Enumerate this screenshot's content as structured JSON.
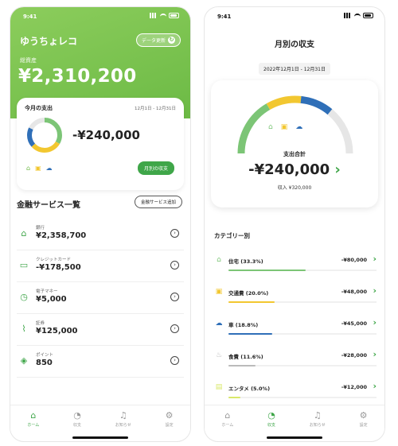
{
  "left": {
    "status_time": "9:41",
    "app_title": "ゆうちょレコ",
    "date_pill": "データ更新",
    "balance_label": "総資産",
    "balance_value": "¥2,310,200",
    "month_card": {
      "title": "今月の支出",
      "range": "12月1日 - 12月31日",
      "amount": "-¥240,000",
      "detail_button": "月別の収支",
      "donut_segments": [
        {
          "share": 0.333,
          "color": "#7cc576"
        },
        {
          "share": 0.3,
          "color": "#f2c730"
        },
        {
          "share": 0.188,
          "color": "#2f6fb8"
        },
        {
          "share": 0.179,
          "color": "#e6e6e6"
        }
      ],
      "mini_icons": [
        "house-icon",
        "car-icon",
        "cloud-icon"
      ]
    },
    "services": {
      "title": "金融サービス一覧",
      "add_button": "金融サービス追加",
      "items": [
        {
          "label": "銀行",
          "value": "¥2,358,700",
          "icon": "bank-icon"
        },
        {
          "label": "クレジットカード",
          "value": "-¥178,500",
          "icon": "card-icon"
        },
        {
          "label": "電子マネー",
          "value": "¥5,000",
          "icon": "emoney-icon"
        },
        {
          "label": "証券",
          "value": "¥125,000",
          "icon": "stocks-icon"
        },
        {
          "label": "ポイント",
          "value": "850",
          "icon": "points-icon"
        }
      ]
    },
    "tabs": [
      {
        "label": "ホーム",
        "icon": "home-icon",
        "active": true
      },
      {
        "label": "収支",
        "icon": "piggy-icon",
        "active": false
      },
      {
        "label": "お知らせ",
        "icon": "bell-icon",
        "active": false
      },
      {
        "label": "設定",
        "icon": "gear-icon",
        "active": false
      }
    ]
  },
  "right": {
    "status_time": "9:41",
    "title": "月別の収支",
    "range": "2022年12月1日 - 12月31日",
    "total_label": "支出合計",
    "total_value": "-¥240,000",
    "total_chevron": "›",
    "income": "収入 ¥320,000",
    "category_header": "カテゴリー別",
    "gauge_colors": [
      "#7cc576",
      "#f2c730",
      "#2f6fb8",
      "#e6e6e6"
    ],
    "categories": [
      {
        "name": "住宅 (33.3%)",
        "value": "-¥80,000",
        "share": 0.333,
        "color": "#7cc576",
        "icon": "house-icon"
      },
      {
        "name": "交通費 (20.0%)",
        "value": "-¥48,000",
        "share": 0.2,
        "color": "#f2c730",
        "icon": "transport-icon"
      },
      {
        "name": "車 (18.8%)",
        "value": "-¥45,000",
        "share": 0.188,
        "color": "#2f6fb8",
        "icon": "car-icon"
      },
      {
        "name": "食費 (11.6%)",
        "value": "-¥28,000",
        "share": 0.116,
        "color": "#bbbbbb",
        "icon": "food-icon"
      },
      {
        "name": "エンタメ (5.0%)",
        "value": "-¥12,000",
        "share": 0.05,
        "color": "#d9e86a",
        "icon": "entertainment-icon"
      }
    ],
    "tabs": [
      {
        "label": "ホーム",
        "icon": "home-icon",
        "active": false
      },
      {
        "label": "収支",
        "icon": "piggy-icon",
        "active": true
      },
      {
        "label": "お知らせ",
        "icon": "bell-icon",
        "active": false
      },
      {
        "label": "設定",
        "icon": "gear-icon",
        "active": false
      }
    ]
  }
}
